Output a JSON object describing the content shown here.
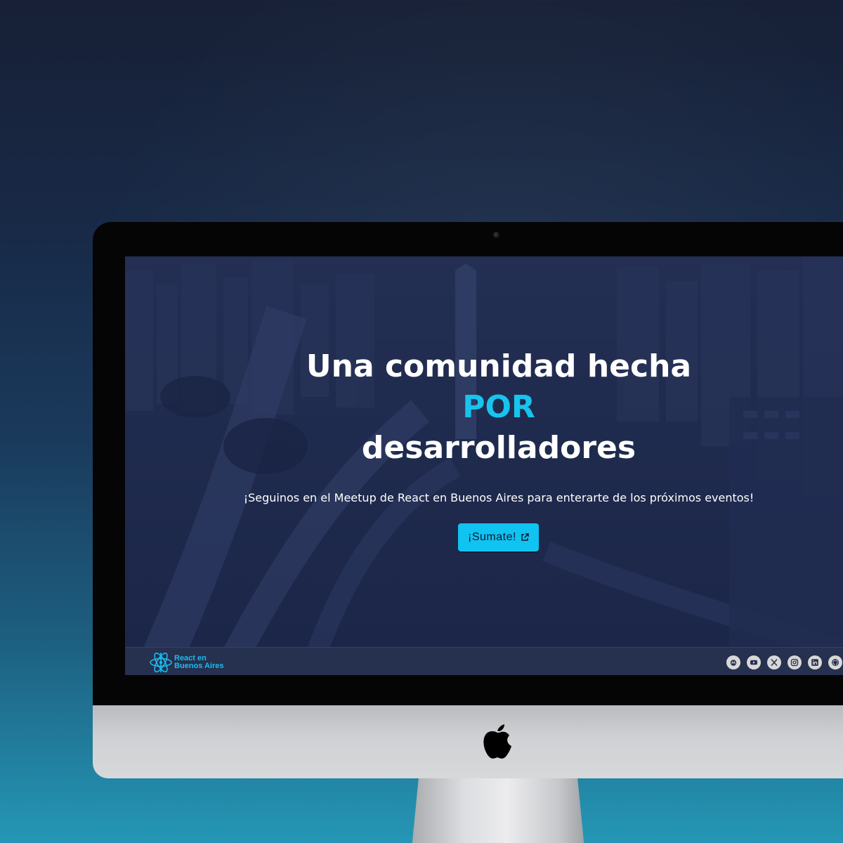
{
  "hero": {
    "title_line1": "Una comunidad hecha",
    "title_accent": "POR",
    "title_line3": "desarrolladores",
    "subtitle": "¡Seguinos en el Meetup de React en Buenos Aires para enterarte de los próximos eventos!",
    "cta_label": "¡Sumate!"
  },
  "footer": {
    "logo_line1": "React en",
    "logo_line2": "Buenos Aires",
    "socials": [
      "meetup-icon",
      "youtube-icon",
      "x-icon",
      "instagram-icon",
      "linkedin-icon",
      "github-icon"
    ]
  },
  "colors": {
    "accent": "#17c4ee",
    "hero_background": "#1e2a4e",
    "footer_background": "#26304f"
  }
}
